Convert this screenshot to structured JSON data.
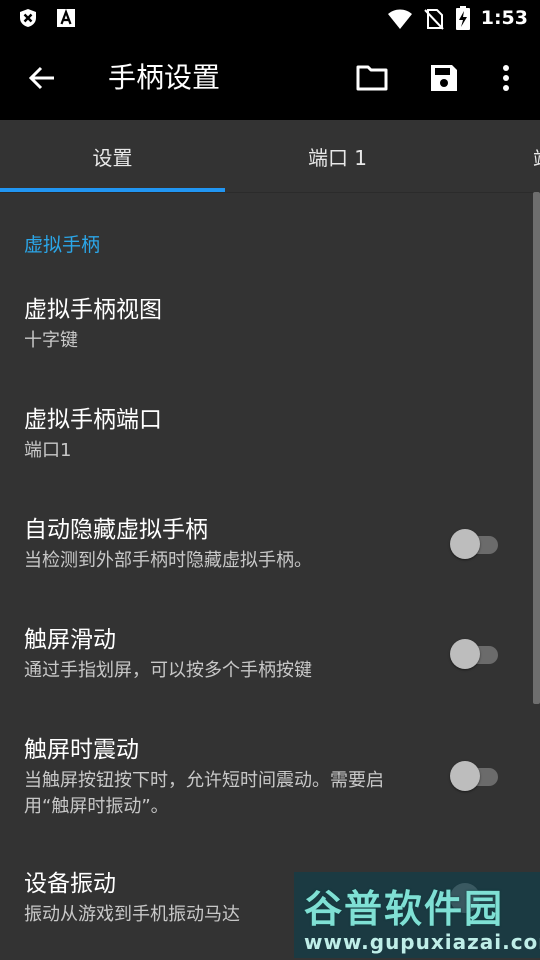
{
  "status_bar": {
    "time": "1:53",
    "left_icons": [
      "shield-x-icon",
      "font-a-icon"
    ],
    "right_icons": [
      "wifi-icon",
      "no-sim-icon",
      "battery-charging-icon"
    ]
  },
  "toolbar": {
    "title": "手柄设置",
    "back_icon": "arrow-left-icon",
    "actions": [
      "folder-icon",
      "save-icon",
      "more-vert-icon"
    ]
  },
  "tabs": [
    {
      "label": "设置",
      "selected": true
    },
    {
      "label": "端口 1",
      "selected": false
    },
    {
      "label": "端",
      "selected": false
    }
  ],
  "section": {
    "header": "虚拟手柄"
  },
  "preferences": [
    {
      "title": "虚拟手柄视图",
      "summary": "十字键",
      "has_switch": false
    },
    {
      "title": "虚拟手柄端口",
      "summary": "端口1",
      "has_switch": false
    },
    {
      "title": "自动隐藏虚拟手柄",
      "summary": "当检测到外部手柄时隐藏虚拟手柄。",
      "has_switch": true,
      "checked": false
    },
    {
      "title": "触屏滑动",
      "summary": "通过手指划屏，可以按多个手柄按键",
      "has_switch": true,
      "checked": false
    },
    {
      "title": "触屏时震动",
      "summary": "当触屏按钮按下时，允许短时间震动。需要启用“触屏时振动”。",
      "has_switch": true,
      "checked": false
    },
    {
      "title": "设备振动",
      "summary": "振动从游戏到手机振动马达",
      "has_switch": true,
      "checked": false
    }
  ],
  "watermark": {
    "main": "谷普软件园",
    "sub": "www.gupuxiazai.com"
  },
  "colors": {
    "accent": "#2196f3",
    "section_header": "#2ba6e8",
    "background": "#333333",
    "bar": "#000000"
  }
}
